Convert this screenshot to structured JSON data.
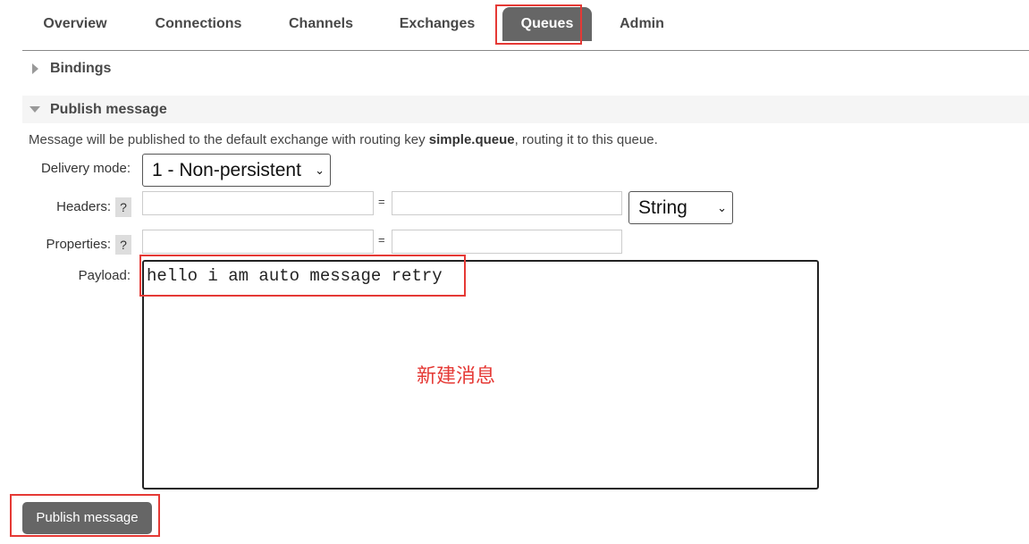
{
  "tabs": [
    {
      "label": "Overview"
    },
    {
      "label": "Connections"
    },
    {
      "label": "Channels"
    },
    {
      "label": "Exchanges"
    },
    {
      "label": "Queues",
      "active": true
    },
    {
      "label": "Admin"
    }
  ],
  "bindings": {
    "title": "Bindings",
    "expanded": false
  },
  "publish": {
    "title": "Publish message",
    "desc_before": "Message will be published to the default exchange with routing key ",
    "routing_key": "simple.queue",
    "desc_after": ", routing it to this queue.",
    "delivery_mode_label": "Delivery mode:",
    "delivery_mode_value": "1 - Non-persistent",
    "headers_label": "Headers:",
    "properties_label": "Properties:",
    "help": "?",
    "equals": "=",
    "header_type": "String",
    "payload_label": "Payload:",
    "payload": "hello i am auto message retry",
    "button": "Publish message"
  },
  "annotation": {
    "text": "新建消息",
    "color": "#e53935"
  }
}
